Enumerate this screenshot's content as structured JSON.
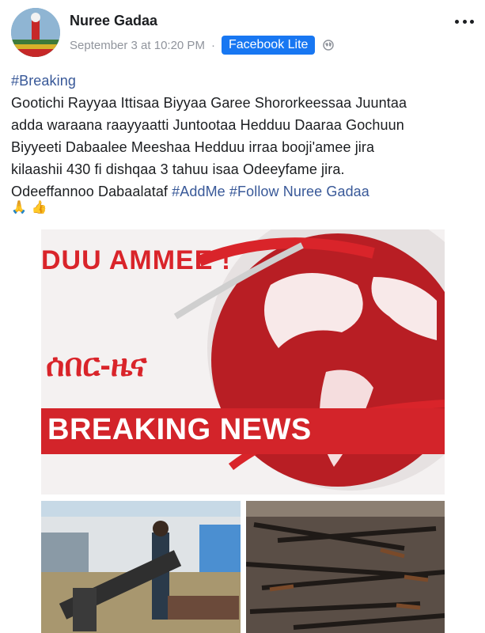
{
  "post": {
    "author": "Nuree Gadaa",
    "timestamp": "September 3 at 10:20 PM",
    "separator": "·",
    "app_badge": "Facebook Lite",
    "text_lines": [
      "#Breaking",
      "Gootichi Rayyaa Ittisaa Biyyaa Garee Shororkeessaa Juuntaa",
      "adda waraana raayyaatti Juntootaa Hedduu Daaraa Gochuun",
      "Biyyeeti Dabaalee Meeshaa Hedduu irraa booji'amee jira",
      "kilaashii 430 fi dishqaa 3 tahuu isaa Odeeyfame jira."
    ],
    "last_line_prefix": "Odeeffannoo Dabaalataf ",
    "hashtag_addme": "#AddMe",
    "hashtag_follow": "#Follow Nuree Gadaa",
    "emojis": [
      "🙏",
      "👍"
    ]
  },
  "images": {
    "main": {
      "top_text": "DUU AMMEE !",
      "amharic_text": "ሰበር-ዜና",
      "banner_text": "BREAKING NEWS"
    }
  },
  "colors": {
    "link": "#385898",
    "badge": "#1877f2",
    "breaking_red": "#d3242a"
  }
}
